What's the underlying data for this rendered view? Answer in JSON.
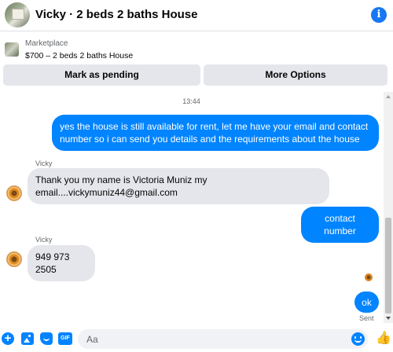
{
  "header": {
    "title": "Vicky · 2 beds 2 baths House",
    "info_icon": "info-icon"
  },
  "marketplace": {
    "label": "Marketplace",
    "listing": "$700 – 2 beds 2 baths House",
    "mark_pending_label": "Mark as pending",
    "more_options_label": "More Options"
  },
  "conversation": {
    "timestamp": "13:44",
    "messages": [
      {
        "from": "me",
        "text": "yes the house is still available for rent, let me have your email  and contact number so i can send you details and the requirements about the house"
      },
      {
        "from": "Vicky",
        "sender_label": "Vicky",
        "text": "Thank you my name is Victoria Muniz my email....vickymuniz44@gmail.com"
      },
      {
        "from": "me",
        "text": "contact number"
      },
      {
        "from": "Vicky",
        "sender_label": "Vicky",
        "text": "949 973 2505"
      },
      {
        "from": "me",
        "text": "ok",
        "status": "Sent"
      }
    ]
  },
  "composer": {
    "placeholder": "Aa",
    "icons": [
      "plus-icon",
      "photo-icon",
      "sticker-icon",
      "gif-icon",
      "emoji-icon",
      "thumbs-up-icon"
    ],
    "gif_label": "GIF"
  },
  "colors": {
    "accent": "#0084ff",
    "incoming_bubble": "#e4e6eb",
    "button_bg": "#e4e6eb"
  }
}
